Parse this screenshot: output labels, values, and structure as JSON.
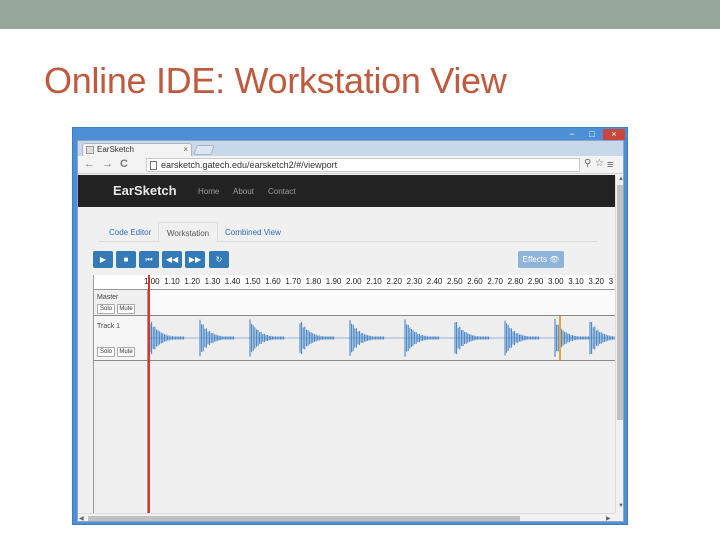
{
  "slide": {
    "title": "Online IDE: Workstation View"
  },
  "window_controls": {
    "minimize": "−",
    "maximize": "□",
    "close": "×"
  },
  "browser": {
    "tab_title": "EarSketch",
    "tab_close": "×",
    "back": "←",
    "forward": "→",
    "reload": "C",
    "url": "earsketch.gatech.edu/earsketch2/#/viewport",
    "search_icon": "⚲",
    "star_icon": "☆",
    "menu_icon": "≡"
  },
  "site": {
    "brand": "EarSketch",
    "nav": [
      "Home",
      "About",
      "Contact"
    ]
  },
  "view_tabs": [
    "Code Editor",
    "Workstation",
    "Combined View"
  ],
  "active_view": "Workstation",
  "transport": {
    "buttons": [
      "▶",
      "■",
      "⏮",
      "◀◀",
      "▶▶",
      "↻"
    ],
    "effects_label": "Effects 👁"
  },
  "timeline": {
    "ticks": [
      "1.00",
      "1.10",
      "1.20",
      "1.30",
      "1.40",
      "1.50",
      "1.60",
      "1.70",
      "1.80",
      "1.90",
      "2.00",
      "2.10",
      "2.20",
      "2.30",
      "2.40",
      "2.50",
      "2.60",
      "2.70",
      "2.80",
      "2.90",
      "3.00",
      "3.10",
      "3.20",
      "3"
    ]
  },
  "tracks": [
    {
      "name": "Master",
      "solo": "Solo",
      "mute": "Mute"
    },
    {
      "name": "Track 1",
      "solo": "Solo",
      "mute": "Mute"
    }
  ],
  "colors": {
    "accent": "#337ab7",
    "title": "#bf5a3e",
    "playhead": "#e0332a",
    "waveform": "#3d7fc4",
    "band": "#97a79c"
  }
}
